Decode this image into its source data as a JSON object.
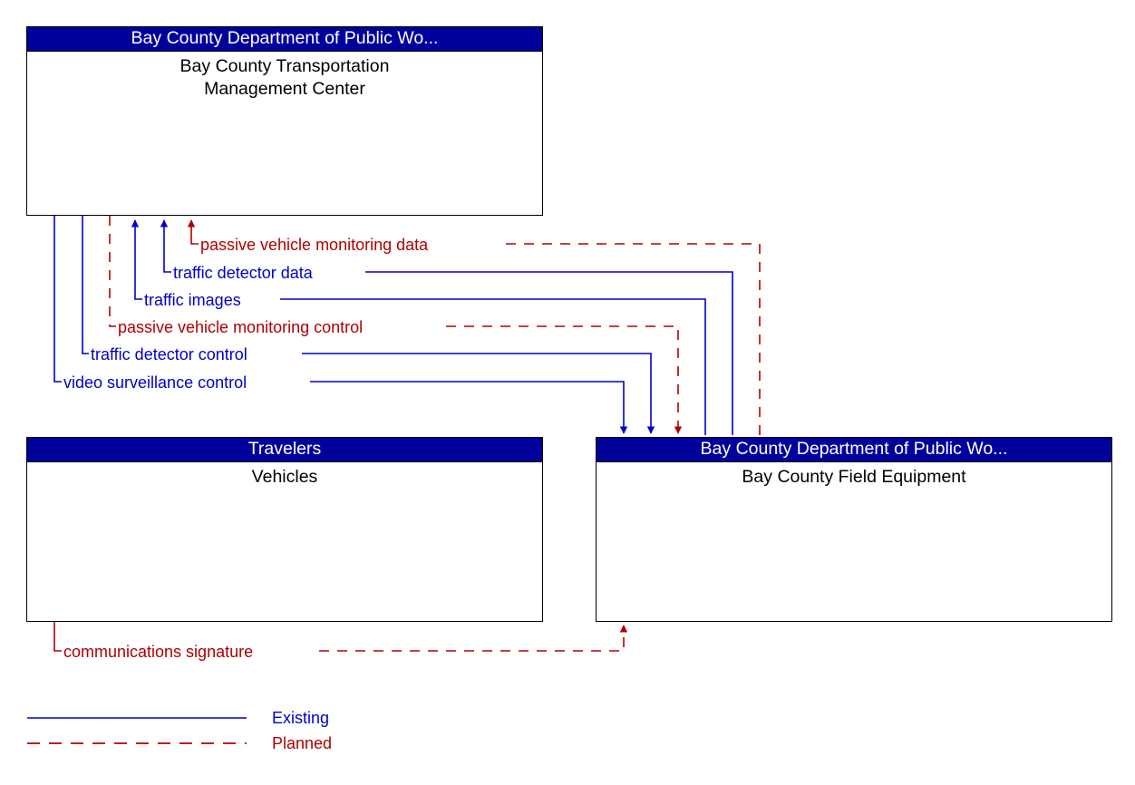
{
  "diagram": {
    "title": "Bay County Transportation Management Center interconnect diagram",
    "colors": {
      "existing": "#0000CC",
      "planned": "#B00000",
      "header_fill": "#00009B",
      "header_text": "#FFFFFF",
      "box_fill": "#FFFFFF",
      "box_border": "#000000"
    }
  },
  "entities": [
    {
      "id": "tmc",
      "stakeholder": "Bay County Department of Public Wo...",
      "name": "Bay County Transportation\nManagement Center"
    },
    {
      "id": "vehicles",
      "stakeholder": "Travelers",
      "name": "Vehicles"
    },
    {
      "id": "field",
      "stakeholder": "Bay County Department of Public Wo...",
      "name": "Bay County Field Equipment"
    }
  ],
  "flows": [
    {
      "id": "passive-vehicle-monitoring-data",
      "label": "passive vehicle monitoring data",
      "status": "Planned",
      "from": "field",
      "to": "tmc"
    },
    {
      "id": "traffic-detector-data",
      "label": "traffic detector data",
      "status": "Existing",
      "from": "field",
      "to": "tmc"
    },
    {
      "id": "traffic-images",
      "label": "traffic images",
      "status": "Existing",
      "from": "field",
      "to": "tmc"
    },
    {
      "id": "passive-vehicle-monitoring-control",
      "label": "passive vehicle monitoring control",
      "status": "Planned",
      "from": "tmc",
      "to": "field"
    },
    {
      "id": "traffic-detector-control",
      "label": "traffic detector control",
      "status": "Existing",
      "from": "tmc",
      "to": "field"
    },
    {
      "id": "video-surveillance-control",
      "label": "video surveillance control",
      "status": "Existing",
      "from": "tmc",
      "to": "field"
    },
    {
      "id": "communications-signature",
      "label": "communications signature",
      "status": "Planned",
      "from": "vehicles",
      "to": "field"
    }
  ],
  "legend": {
    "existing": "Existing",
    "planned": "Planned"
  }
}
